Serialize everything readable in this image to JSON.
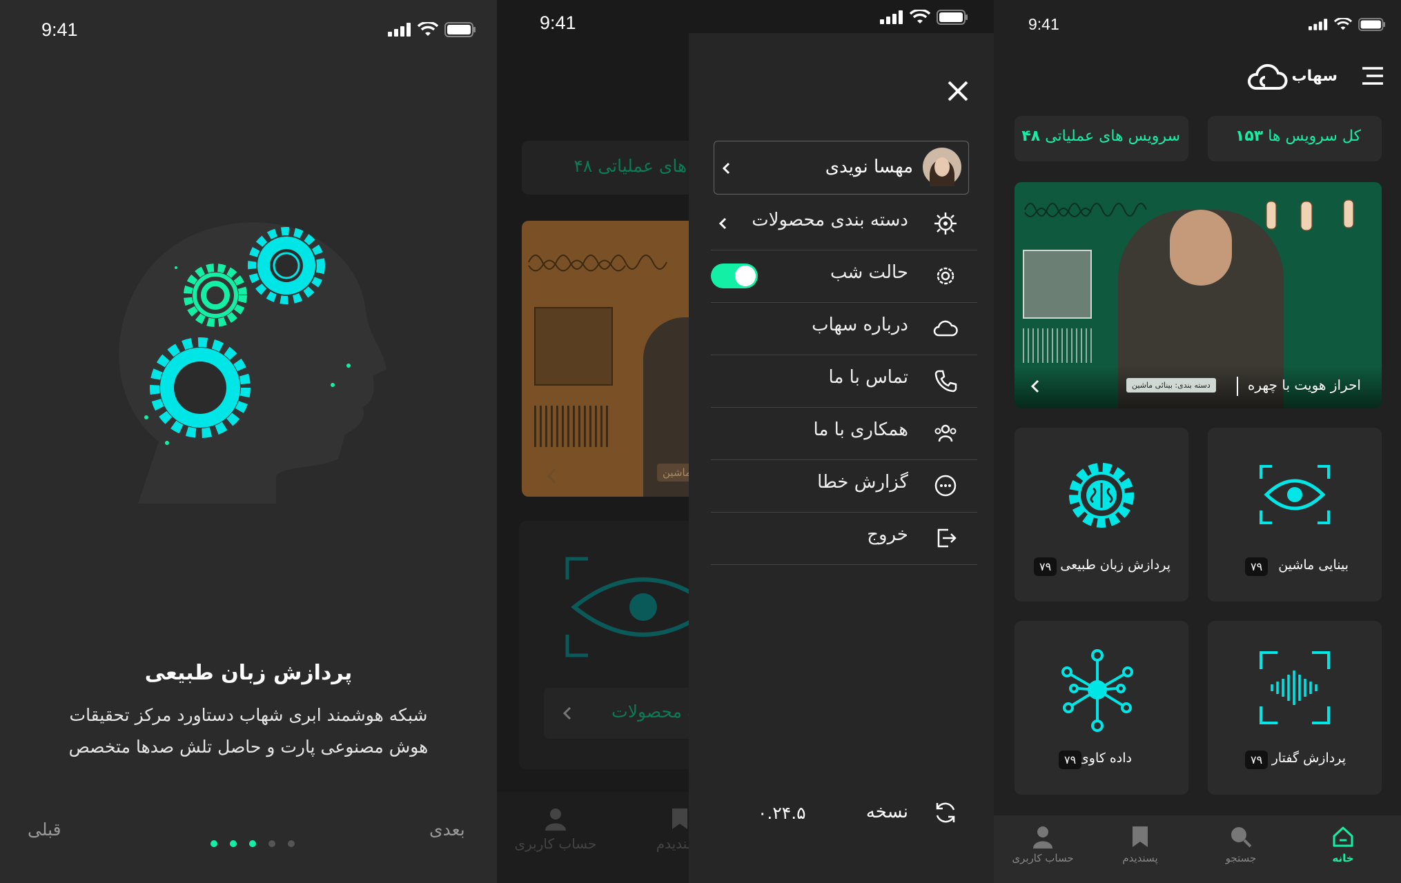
{
  "status_bar": {
    "time": "9:41"
  },
  "onboarding": {
    "title": "پردازش زبان طبیعی",
    "description_line1": "شبکه هوشمند ابری شهاب دستاورد مرکز تحقیقات",
    "description_line2": "هوش مصنوعی پارت و حاصل تلش صدها متخصص",
    "prev_label": "قبلی",
    "next_label": "بعدی",
    "pages_total": 5,
    "page_active": 3
  },
  "background_home": {
    "operational_partial": "یس های عملیاتی ۴۸",
    "view_products_partial": "شاهده محصولات",
    "caption_partial": "ماشین",
    "nav_account_partial": "حساب کاربری",
    "nav_fav_partial": "پسندیدم"
  },
  "drawer": {
    "user_name": "مهسا نویدی",
    "items": [
      {
        "label": "دسته بندی محصولات",
        "icon": "category-icon"
      },
      {
        "label": "حالت شب",
        "icon": "gear-icon"
      },
      {
        "label": "درباره سهاب",
        "icon": "cloud-icon"
      },
      {
        "label": "تماس با ما",
        "icon": "phone-icon"
      },
      {
        "label": "همکاری با ما",
        "icon": "team-icon"
      },
      {
        "label": "گزارش خطا",
        "icon": "chat-icon"
      },
      {
        "label": "خروج",
        "icon": "logout-icon"
      }
    ],
    "night_mode_on": true,
    "version_label": "نسخه",
    "version_value": "۰.۲۴.۵"
  },
  "home": {
    "brand": "سهاب",
    "stat_total_label": "کل سرویس ها",
    "stat_total_value": "۱۵۳",
    "stat_ops_label": "سرویس های عملیاتی",
    "stat_ops_value": "۴۸",
    "banner_title": "احراز هویت با چهره",
    "banner_tag": "دسته بندی: بینائی ماشین",
    "categories": [
      {
        "label": "بینایی ماشین",
        "count": "۷۹",
        "icon": "eye-scan-icon"
      },
      {
        "label": "پردازش زبان طبیعی",
        "count": "۷۹",
        "icon": "brain-gear-icon"
      },
      {
        "label": "پردازش گفتار",
        "count": "۷۹",
        "icon": "voice-scan-icon"
      },
      {
        "label": "داده کاوی",
        "count": "۷۹",
        "icon": "network-icon"
      }
    ],
    "nav": [
      {
        "label": "خانه",
        "icon": "home-icon",
        "active": true
      },
      {
        "label": "جستجو",
        "icon": "search-icon",
        "active": false
      },
      {
        "label": "پسندیدم",
        "icon": "bookmark-icon",
        "active": false
      },
      {
        "label": "حساب کاربری",
        "icon": "user-icon",
        "active": false
      }
    ]
  },
  "colors": {
    "accent": "#13f0a6",
    "cyan": "#00e5e5",
    "bg": "#212121",
    "card": "#2b2b2b",
    "banner": "#0f5a3e"
  }
}
